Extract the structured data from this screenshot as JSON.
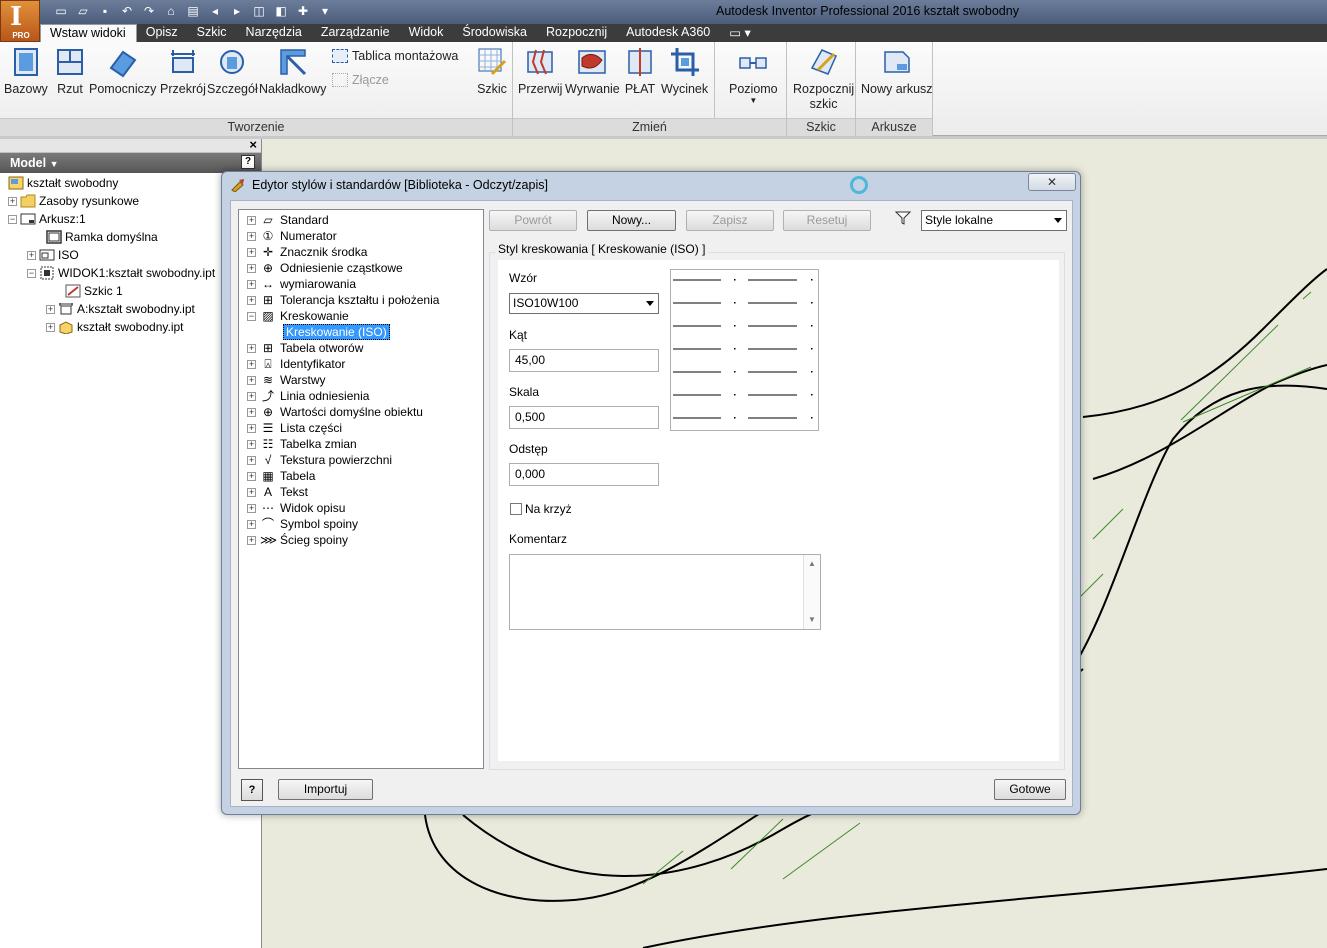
{
  "app": {
    "logo_letter": "I",
    "logo_badge": "PRO",
    "title": "Autodesk Inventor Professional 2016   kształt swobodny"
  },
  "ribbon_tabs": [
    {
      "label": "Wstaw widoki",
      "active": true
    },
    {
      "label": "Opisz"
    },
    {
      "label": "Szkic"
    },
    {
      "label": "Narzędzia"
    },
    {
      "label": "Zarządzanie"
    },
    {
      "label": "Widok"
    },
    {
      "label": "Środowiska"
    },
    {
      "label": "Rozpocznij"
    },
    {
      "label": "Autodesk A360"
    },
    {
      "label": "▭ ▾"
    }
  ],
  "ribbon": {
    "buttons": {
      "bazowy": "Bazowy",
      "rzut": "Rzut",
      "pomocniczy": "Pomocniczy",
      "przekroj": "Przekrój",
      "szczegol": "Szczegół",
      "nakladkowy": "Nakładkowy",
      "tablica": "Tablica montażowa",
      "zlacze": "Złącze",
      "szkic": "Szkic",
      "przerwij": "Przerwij",
      "wyrwanie": "Wyrwanie",
      "plat": "PŁAT",
      "wycinek": "Wycinek",
      "poziomo": "Poziomo",
      "rozpocznij_1": "Rozpocznij",
      "rozpocznij_2": "szkic",
      "nowy_arkusz": "Nowy arkusz"
    },
    "groups": {
      "tworzenie": "Tworzenie",
      "zmien": "Zmień",
      "szkic": "Szkic",
      "arkusze": "Arkusze"
    }
  },
  "browser": {
    "title": "Model",
    "close": "×",
    "help": "?",
    "items": [
      {
        "label": "kształt swobodny"
      },
      {
        "label": "Zasoby rysunkowe"
      },
      {
        "label": "Arkusz:1"
      },
      {
        "label": "Ramka domyślna"
      },
      {
        "label": "ISO"
      },
      {
        "label": "WIDOK1:kształt swobodny.ipt"
      },
      {
        "label": "Szkic 1"
      },
      {
        "label": "A:kształt swobodny.ipt"
      },
      {
        "label": "kształt swobodny.ipt"
      }
    ]
  },
  "dialog": {
    "title": "Edytor stylów i standardów [Biblioteka - Odczyt/zapis]",
    "close": "✕",
    "buttons": {
      "powrot": "Powrót",
      "nowy": "Nowy...",
      "zapisz": "Zapisz",
      "resetuj": "Resetuj",
      "importuj": "Importuj",
      "gotowe": "Gotowe",
      "help": "?"
    },
    "filter_value": "Style lokalne",
    "tree": [
      "Standard",
      "Numerator",
      "Znacznik środka",
      "Odniesienie cząstkowe",
      "wymiarowania",
      "Tolerancja kształtu i położenia",
      "Kreskowanie",
      "Kreskowanie (ISO)",
      "Tabela otworów",
      "Identyfikator",
      "Warstwy",
      "Linia odniesienia",
      "Wartości domyślne obiektu",
      "Lista części",
      "Tabelka zmian",
      "Tekstura powierzchni",
      "Tabela",
      "Tekst",
      "Widok opisu",
      "Symbol spoiny",
      "Ścieg spoiny"
    ],
    "group_caption": "Styl kreskowania [ Kreskowanie (ISO) ]",
    "fields": {
      "wzor_label": "Wzór",
      "wzor_value": "ISO10W100",
      "kat_label": "Kąt",
      "kat_value": "45,00",
      "skala_label": "Skala",
      "skala_value": "0,500",
      "odstep_label": "Odstęp",
      "odstep_value": "0,000",
      "na_krzyz_label": "Na krzyż",
      "na_krzyz_checked": false,
      "komentarz_label": "Komentarz",
      "komentarz_value": ""
    }
  },
  "colors": {
    "title_bar": "#5a6c8a",
    "tab_bar": "#3c3c3c",
    "drawing_bg": "#eaeadc",
    "hatch": "#3d8a2c",
    "selection": "#3399ff"
  }
}
